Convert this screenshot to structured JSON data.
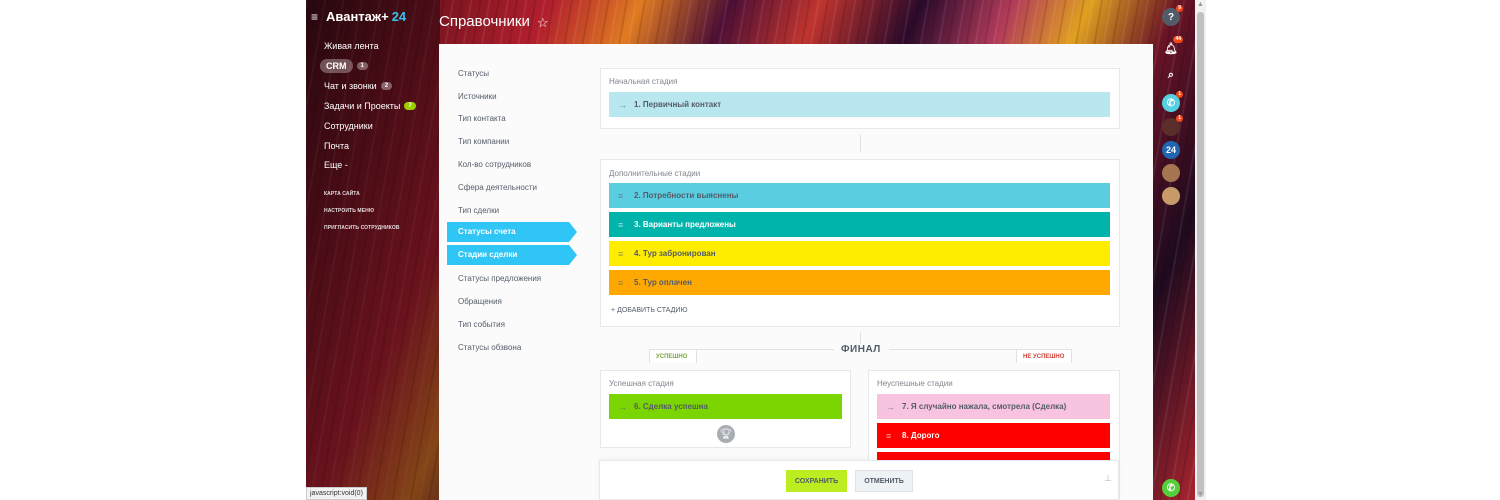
{
  "logo": {
    "name": "Авантаж+",
    "num": "24"
  },
  "left_menu": {
    "items": [
      {
        "label": "Живая лента",
        "counter": ""
      },
      {
        "label": "CRM",
        "counter": "1"
      },
      {
        "label": "Чат и звонки",
        "counter": "2"
      },
      {
        "label": "Задачи и Проекты",
        "counter": "7"
      },
      {
        "label": "Сотрудники",
        "counter": ""
      },
      {
        "label": "Почта",
        "counter": ""
      },
      {
        "label": "Еще -",
        "counter": ""
      }
    ],
    "small_links": [
      "КАРТА САЙТА",
      "НАСТРОИТЬ МЕНЮ",
      "ПРИГЛАСИТЬ СОТРУДНИКОВ"
    ]
  },
  "header": {
    "title": "Справочники",
    "star": "☆"
  },
  "right_panel": {
    "help_badge": "9",
    "notify_badge": "44",
    "call_badge": "1",
    "avatar_badge": "1",
    "b24_label": "24"
  },
  "nav": {
    "items": [
      "Статусы",
      "Источники",
      "Тип контакта",
      "Тип компании",
      "Кол-во сотрудников",
      "Сфера деятельности",
      "Тип сделки",
      "Статусы счета",
      "Стадии сделки",
      "Статусы предложения",
      "Обращения",
      "Тип события",
      "Статусы обзвона"
    ],
    "active": [
      "Статусы счета",
      "Стадии сделки"
    ]
  },
  "initial": {
    "title": "Начальная стадия",
    "stage": "1. Первичный контакт",
    "color": "#b9e7ef"
  },
  "additional": {
    "title": "Дополнительные стадии",
    "stages": [
      {
        "label": "2. Потребности выяснены",
        "color": "#5acde0",
        "text": "#535c69"
      },
      {
        "label": "3. Варианты предложены",
        "color": "#00b4ac",
        "text": "#ffffff"
      },
      {
        "label": "4. Тур забронирован",
        "color": "#ffed00",
        "text": "#535c69"
      },
      {
        "label": "5. Тур оплачен",
        "color": "#ffa900",
        "text": "#535c69"
      }
    ],
    "add_label": "ДОБАВИТЬ СТАДИЮ"
  },
  "final": {
    "title": "ФИНАЛ",
    "success_tag": "УСПЕШНО",
    "fail_tag": "НЕ УСПЕШНО"
  },
  "success": {
    "title": "Успешная стадия",
    "stage": "6. Сделка успешна",
    "color": "#7bd500"
  },
  "failure": {
    "title": "Неуспешные стадии",
    "stages": [
      {
        "label": "7. Я случайно нажала, смотрела (Сделка)",
        "color": "#f8c3df",
        "text": "#535c69"
      },
      {
        "label": "8. Дорого",
        "color": "#ff0000",
        "text": "#ffffff"
      }
    ]
  },
  "buttons": {
    "save": "СОХРАНИТЬ",
    "cancel": "ОТМЕНИТЬ"
  },
  "status_tip": "javascript:void(0)"
}
